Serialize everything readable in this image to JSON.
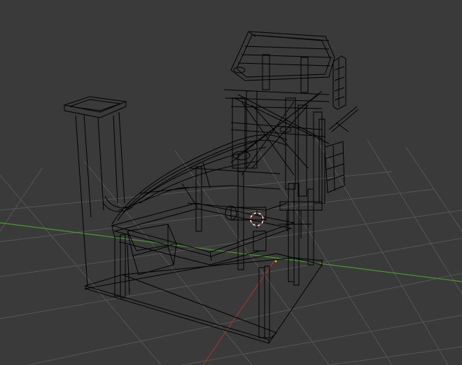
{
  "viewport": {
    "view_mode": "wireframe",
    "colors": {
      "background": "#3a3a3a",
      "grid": "#555555",
      "x_axis": "#9a3535",
      "y_axis": "#4a9a2c",
      "wire": "#000000",
      "cursor_red": "#e23b3b",
      "cursor_white": "#ffffff",
      "origin": "#e0b020"
    },
    "icons": [
      "3d-cursor-icon",
      "object-origin-icon"
    ]
  }
}
